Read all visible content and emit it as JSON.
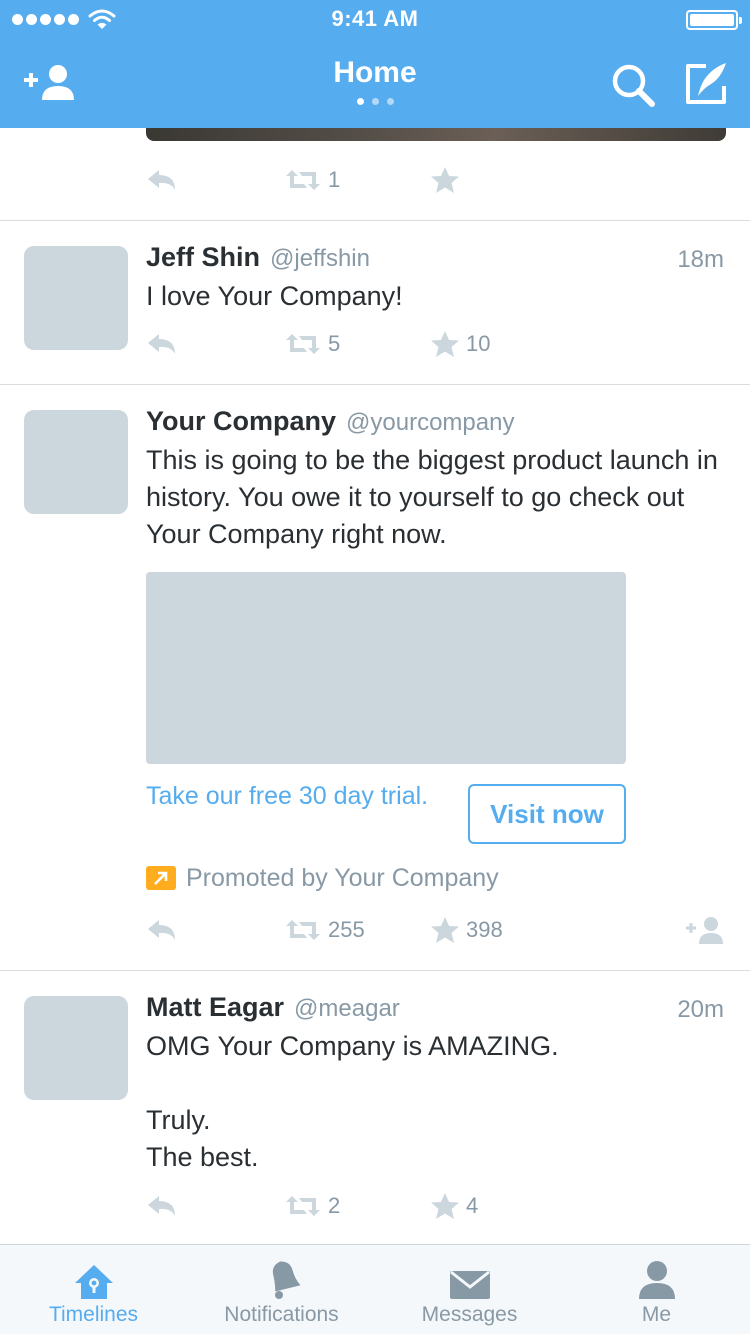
{
  "status_bar": {
    "time": "9:41 AM"
  },
  "nav": {
    "title": "Home",
    "page_count": 3,
    "active_page": 1
  },
  "colors": {
    "brand": "#55acee",
    "icon_gray": "#ccd6dd",
    "text_gray": "#8899a6",
    "promoted": "#ffad1f"
  },
  "icons": {
    "add_friend": "add-user-icon",
    "search": "search-icon",
    "compose": "compose-icon",
    "reply": "reply-icon",
    "retweet": "retweet-icon",
    "favorite": "star-icon",
    "follow": "follow-icon",
    "promoted": "promoted-arrow-icon"
  },
  "timeline": {
    "partial_tweet": {
      "retweets": "1",
      "favorites": ""
    },
    "tweets": [
      {
        "name": "Jeff Shin",
        "handle": "@jeffshin",
        "time": "18m",
        "text": "I love Your Company!",
        "retweets": "5",
        "favorites": "10"
      },
      {
        "name": "Your Company",
        "handle": "@yourcompany",
        "time": "",
        "text": "This is going to be the biggest product launch in history. You owe it to yourself to go check out Your Company right now.",
        "card": {
          "cta_text": "Take our free 30 day trial.",
          "button_label": "Visit now"
        },
        "promoted_label": "Promoted by Your Company",
        "retweets": "255",
        "favorites": "398"
      },
      {
        "name": "Matt Eagar",
        "handle": "@meagar",
        "time": "20m",
        "text": "OMG Your Company is AMAZING.\n\nTruly.\nThe best.",
        "retweets": "2",
        "favorites": "4"
      }
    ]
  },
  "tabs": [
    {
      "label": "Timelines",
      "icon": "home-icon",
      "active": true
    },
    {
      "label": "Notifications",
      "icon": "bell-icon",
      "active": false
    },
    {
      "label": "Messages",
      "icon": "envelope-icon",
      "active": false
    },
    {
      "label": "Me",
      "icon": "profile-icon",
      "active": false
    }
  ]
}
